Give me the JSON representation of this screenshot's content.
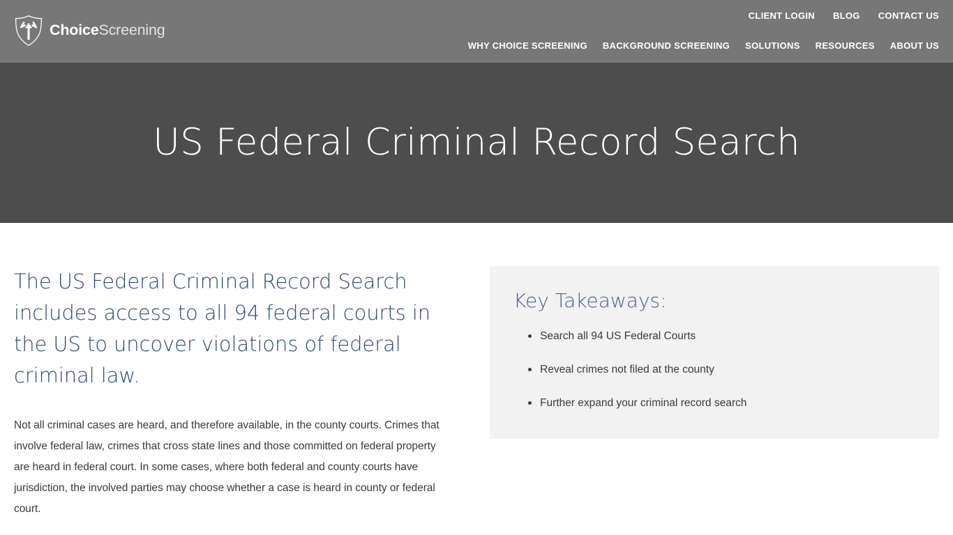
{
  "header": {
    "logo": {
      "icon": "shield-burst-icon",
      "name_bold": "Choice",
      "name_light": "Screening"
    },
    "utility_nav": [
      {
        "label": "CLIENT LOGIN"
      },
      {
        "label": "BLOG"
      },
      {
        "label": "CONTACT US"
      }
    ],
    "main_nav": [
      {
        "label": "WHY CHOICE SCREENING"
      },
      {
        "label": "BACKGROUND SCREENING"
      },
      {
        "label": "SOLUTIONS"
      },
      {
        "label": "RESOURCES"
      },
      {
        "label": "ABOUT US"
      }
    ]
  },
  "hero": {
    "title": "US Federal Criminal Record Search",
    "background_color": "#4d4d4d"
  },
  "main": {
    "lead_heading": "The US Federal Criminal Record Search includes access to all 94 federal courts in the US to uncover violations of federal criminal law.",
    "body_paragraph": "Not all criminal cases are heard, and therefore available, in the county courts. Crimes that involve federal law, crimes that cross state lines and those committed on federal property are heard in federal court. In some cases, where both federal and county courts have jurisdiction, the involved parties may choose whether a case is heard in county or federal court."
  },
  "takeaways": {
    "title": "Key Takeaways:",
    "items": [
      {
        "label": "Search all 94 US Federal Courts"
      },
      {
        "label": "Reveal crimes not filed at the county"
      },
      {
        "label": "Further expand your criminal record search"
      }
    ],
    "background_color": "#f2f2f2"
  },
  "colors": {
    "header_bar": "#777777",
    "hero_bar": "#4d4d4d",
    "accent_blue": "#2e4a7d",
    "takeaway_heading": "#4f5f86",
    "body_text": "#3a3a3a"
  }
}
